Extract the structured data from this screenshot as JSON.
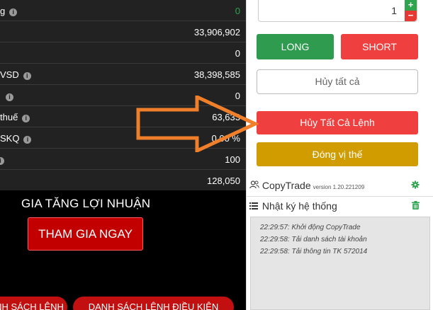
{
  "account_table": {
    "rows": [
      {
        "label": "g",
        "value": "0",
        "value_color": "#2ea44f"
      },
      {
        "label": "",
        "value": "33,906,902"
      },
      {
        "label": "",
        "value": "0"
      },
      {
        "label": "VSD",
        "value": "38,398,585"
      },
      {
        "label": "",
        "value": "0"
      },
      {
        "label": "thuế",
        "value": "63,633"
      },
      {
        "label": "SKQ",
        "value": "0.00 %"
      },
      {
        "label": "",
        "value": "100"
      },
      {
        "label": "",
        "value": "128,050"
      }
    ]
  },
  "promo": {
    "title": "GIA TĂNG LỢI NHUẬN",
    "button": "THAM GIA NGAY"
  },
  "bottom_tabs": [
    {
      "label": "DANH SÁCH LỆNH"
    },
    {
      "label": "DANH SÁCH LỆNH ĐIỀU KIỆN"
    }
  ],
  "order_panel": {
    "quantity": "1",
    "plus": "+",
    "minus": "−",
    "long_label": "LONG",
    "short_label": "SHORT",
    "cancel_all_label": "Hủy tất cả",
    "cancel_orders_label": "Hủy Tất Cả Lệnh",
    "close_position_label": "Đóng vị thế"
  },
  "copytrade": {
    "title": "CopyTrade",
    "version": "version 1.20.221209",
    "icon": "people-icon",
    "settings_icon": "gear-icon"
  },
  "system_log": {
    "title": "Nhật ký hệ thống",
    "icon": "list-icon",
    "delete_icon": "trash-icon",
    "lines": [
      "22:29:57: Khởi động CopyTrade",
      "22:29:58: Tải danh sách tài khoản",
      "22:29:58: Tải thông tin TK 572014"
    ]
  },
  "colors": {
    "long": "#2e9b4e",
    "short": "#ef3f3f",
    "close_position": "#d19c00",
    "arrow": "#f07f2b"
  }
}
